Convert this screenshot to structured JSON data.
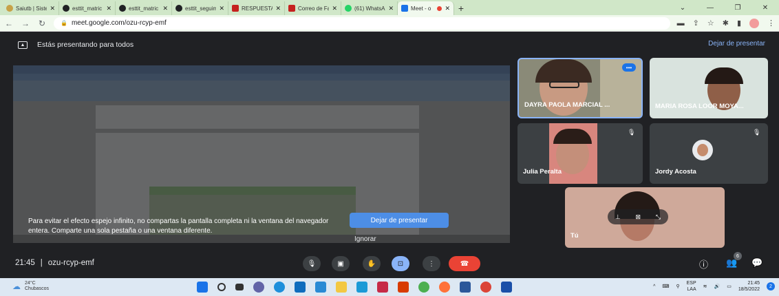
{
  "browser": {
    "tabs": [
      {
        "label": "Saiutb | Siste",
        "color": "#c7a248"
      },
      {
        "label": "esttit_matric",
        "color": "#202124"
      },
      {
        "label": "esttit_matric",
        "color": "#202124"
      },
      {
        "label": "esttit_seguim",
        "color": "#202124"
      },
      {
        "label": "RESPUESTA",
        "color": "#c5221f"
      },
      {
        "label": "Correo de Fa",
        "color": "#c5221f"
      },
      {
        "label": "(61) WhatsAp",
        "color": "#25d366"
      },
      {
        "label": "Meet - o",
        "color": "#1a73e8",
        "active": true
      }
    ],
    "new_tab": "+",
    "url": "meet.google.com/ozu-rcyp-emf"
  },
  "presenting_bar": {
    "text": "Estás presentando para todos",
    "stop": "Dejar de presentar"
  },
  "share_overlay": {
    "message": "Para evitar el efecto espejo infinito, no compartas la pantalla completa ni la ventana del navegador entera. Comparte una sola pestaña o una ventana diferente.",
    "primary": "Dejar de presentar",
    "secondary": "Ignorar"
  },
  "participants": [
    {
      "name": "DAYRA PAOLA MARCIAL ..."
    },
    {
      "name": "MARIA ROSA LOOR MOYA..."
    },
    {
      "name": "Julia Peralta"
    },
    {
      "name": "Jordy Acosta"
    },
    {
      "name": "Tú"
    }
  ],
  "controls": {
    "time": "21:45",
    "separator": "|",
    "meeting_code": "ozu-rcyp-emf",
    "participant_count": "6"
  },
  "taskbar": {
    "temp": "24°C",
    "weather": "Chubascos",
    "lang": "ESP",
    "layout": "LAA",
    "time": "21:45",
    "date": "18/5/2022",
    "notifications": "2"
  }
}
